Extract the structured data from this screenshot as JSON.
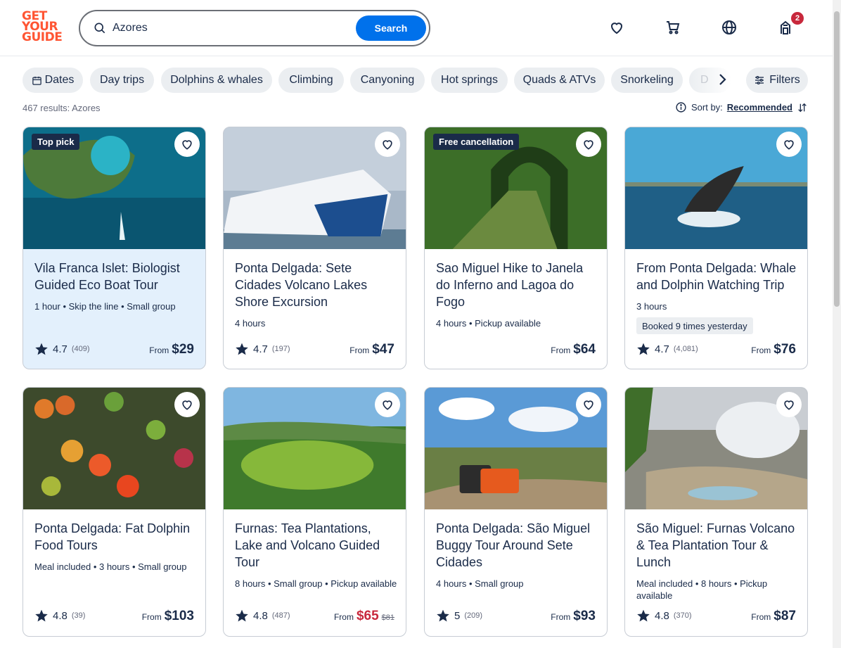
{
  "logo": {
    "line1": "GET",
    "line2": "YOUR",
    "line3": "GUIDE"
  },
  "search": {
    "value": "Azores",
    "button": "Search"
  },
  "header": {
    "cart_count": "2"
  },
  "chips": [
    "Dates",
    "Day trips",
    "Dolphins & whales",
    "Climbing",
    "Canyoning",
    "Hot springs",
    "Quads & ATVs",
    "Snorkeling",
    "D"
  ],
  "filters_label": "Filters",
  "results_text": "467 results: Azores",
  "sort": {
    "label": "Sort by:",
    "value": "Recommended"
  },
  "colors": {
    "brand": "#ff5533",
    "accent": "#0071eb",
    "sale": "#c8283c",
    "text": "#1a2b49"
  },
  "cards": [
    {
      "tag": "Top pick",
      "title": "Vila Franca Islet: Biologist Guided Eco Boat Tour",
      "meta": "1 hour • Skip the line • Small group",
      "booked": "",
      "rating": "4.7",
      "count": "(409)",
      "from": "From",
      "price": "$29",
      "old_price": ""
    },
    {
      "tag": "",
      "title": "Ponta Delgada: Sete Cidades Volcano Lakes Shore Excursion",
      "meta": "4 hours",
      "booked": "",
      "rating": "4.7",
      "count": "(197)",
      "from": "From",
      "price": "$47",
      "old_price": ""
    },
    {
      "tag": "Free cancellation",
      "title": "Sao Miguel Hike to Janela do Inferno and Lagoa do Fogo",
      "meta": "4 hours • Pickup available",
      "booked": "",
      "rating": "",
      "count": "",
      "from": "From",
      "price": "$64",
      "old_price": ""
    },
    {
      "tag": "",
      "title": "From Ponta Delgada: Whale and Dolphin Watching Trip",
      "meta": "3 hours",
      "booked": "Booked 9 times yesterday",
      "rating": "4.7",
      "count": "(4,081)",
      "from": "From",
      "price": "$76",
      "old_price": ""
    },
    {
      "tag": "",
      "title": "Ponta Delgada: Fat Dolphin Food Tours",
      "meta": "Meal included • 3 hours • Small group",
      "booked": "",
      "rating": "4.8",
      "count": "(39)",
      "from": "From",
      "price": "$103",
      "old_price": ""
    },
    {
      "tag": "",
      "title": "Furnas: Tea Plantations, Lake and Volcano Guided Tour",
      "meta": "8 hours • Small group • Pickup available",
      "booked": "",
      "rating": "4.8",
      "count": "(487)",
      "from": "From",
      "price": "$65",
      "old_price": "$81"
    },
    {
      "tag": "",
      "title": "Ponta Delgada: São Miguel Buggy Tour Around Sete Cidades",
      "meta": "4 hours • Small group",
      "booked": "",
      "rating": "5",
      "count": "(209)",
      "from": "From",
      "price": "$93",
      "old_price": ""
    },
    {
      "tag": "",
      "title": "São Miguel: Furnas Volcano & Tea Plantation Tour & Lunch",
      "meta": "Meal included • 8 hours • Pickup available",
      "booked": "",
      "rating": "4.8",
      "count": "(370)",
      "from": "From",
      "price": "$87",
      "old_price": ""
    }
  ]
}
